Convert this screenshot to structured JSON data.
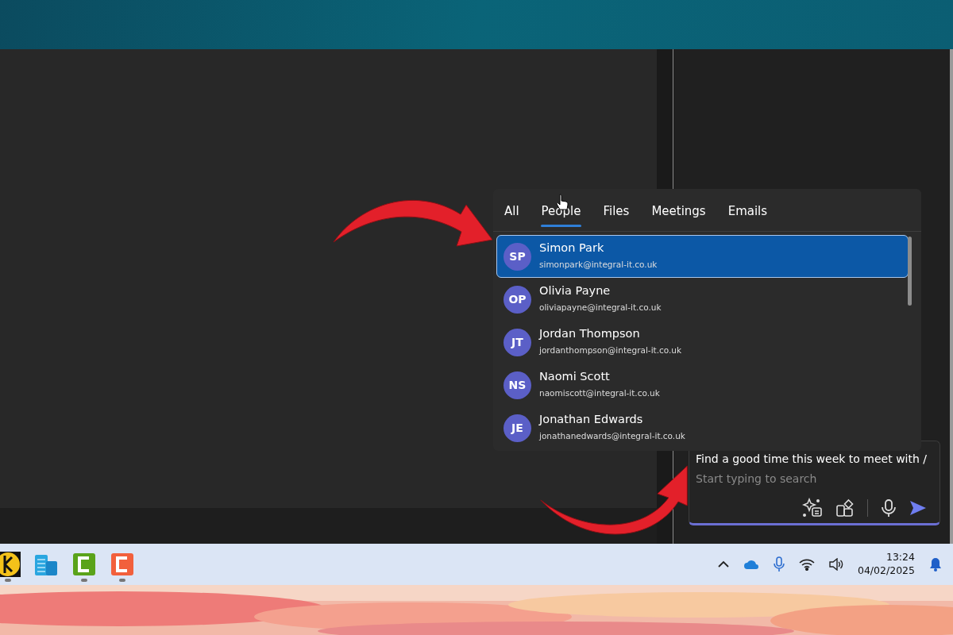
{
  "search_popup": {
    "tabs": [
      {
        "label": "All",
        "selected": false
      },
      {
        "label": "People",
        "selected": true
      },
      {
        "label": "Files",
        "selected": false
      },
      {
        "label": "Meetings",
        "selected": false
      },
      {
        "label": "Emails",
        "selected": false
      }
    ],
    "people": [
      {
        "initials": "SP",
        "name": "Simon Park",
        "email": "simonpark@integral-it.co.uk",
        "selected": true
      },
      {
        "initials": "OP",
        "name": "Olivia Payne",
        "email": "oliviapayne@integral-it.co.uk",
        "selected": false
      },
      {
        "initials": "JT",
        "name": "Jordan Thompson",
        "email": "jordanthompson@integral-it.co.uk",
        "selected": false
      },
      {
        "initials": "NS",
        "name": "Naomi Scott",
        "email": "naomiscott@integral-it.co.uk",
        "selected": false
      },
      {
        "initials": "JE",
        "name": "Jonathan Edwards",
        "email": "jonathanedwards@integral-it.co.uk",
        "selected": false
      }
    ]
  },
  "compose": {
    "value": "Find a good time this week to meet with /",
    "placeholder": "Start typing to search"
  },
  "taskbar": {
    "apps": [
      {
        "kind": "keeper",
        "running": true
      },
      {
        "kind": "servers",
        "running": false
      },
      {
        "kind": "green-c",
        "running": true
      },
      {
        "kind": "orange-c",
        "running": true
      }
    ],
    "time": "13:24",
    "date": "04/02/2025"
  }
}
